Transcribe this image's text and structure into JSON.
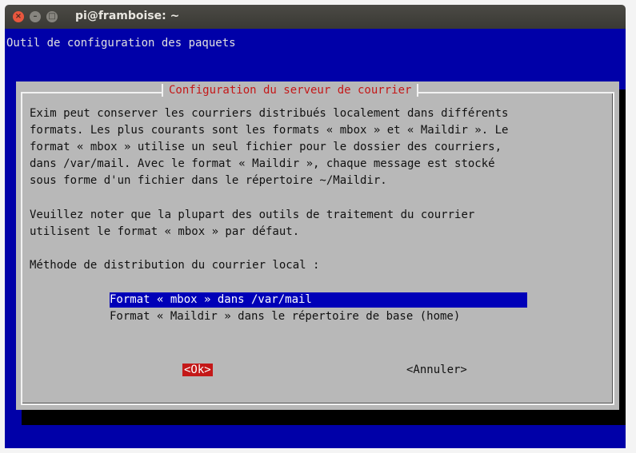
{
  "window": {
    "title": "pi@framboise: ~",
    "controls": [
      "close-icon",
      "minimize-icon",
      "maximize-icon"
    ]
  },
  "terminal": {
    "backtitle": "Outil de configuration des paquets"
  },
  "dialog": {
    "title": "Configuration du serveur de courrier",
    "paragraph1": [
      "Exim peut conserver les courriers distribués localement dans différents",
      "formats. Les plus courants sont les formats « mbox » et « Maildir ». Le",
      "format « mbox » utilise un seul fichier pour le dossier des courriers,",
      "dans /var/mail. Avec le format « Maildir », chaque message est stocké",
      "sous forme d'un fichier dans le répertoire ~/Maildir."
    ],
    "paragraph2": [
      "Veuillez noter que la plupart des outils de traitement du courrier",
      "utilisent le format « mbox » par défaut."
    ],
    "prompt": "Méthode de distribution du courrier local :",
    "options": [
      {
        "label": "Format « mbox » dans /var/mail",
        "selected": true
      },
      {
        "label": "Format « Maildir » dans le répertoire de base (home)",
        "selected": false
      }
    ],
    "ok_label": "<Ok>",
    "cancel_label": "<Annuler>"
  },
  "colors": {
    "terminal_bg": "#0000a8",
    "dialog_bg": "#b8b8b8",
    "title_red": "#c41818",
    "selection_bg": "#0000b8"
  }
}
